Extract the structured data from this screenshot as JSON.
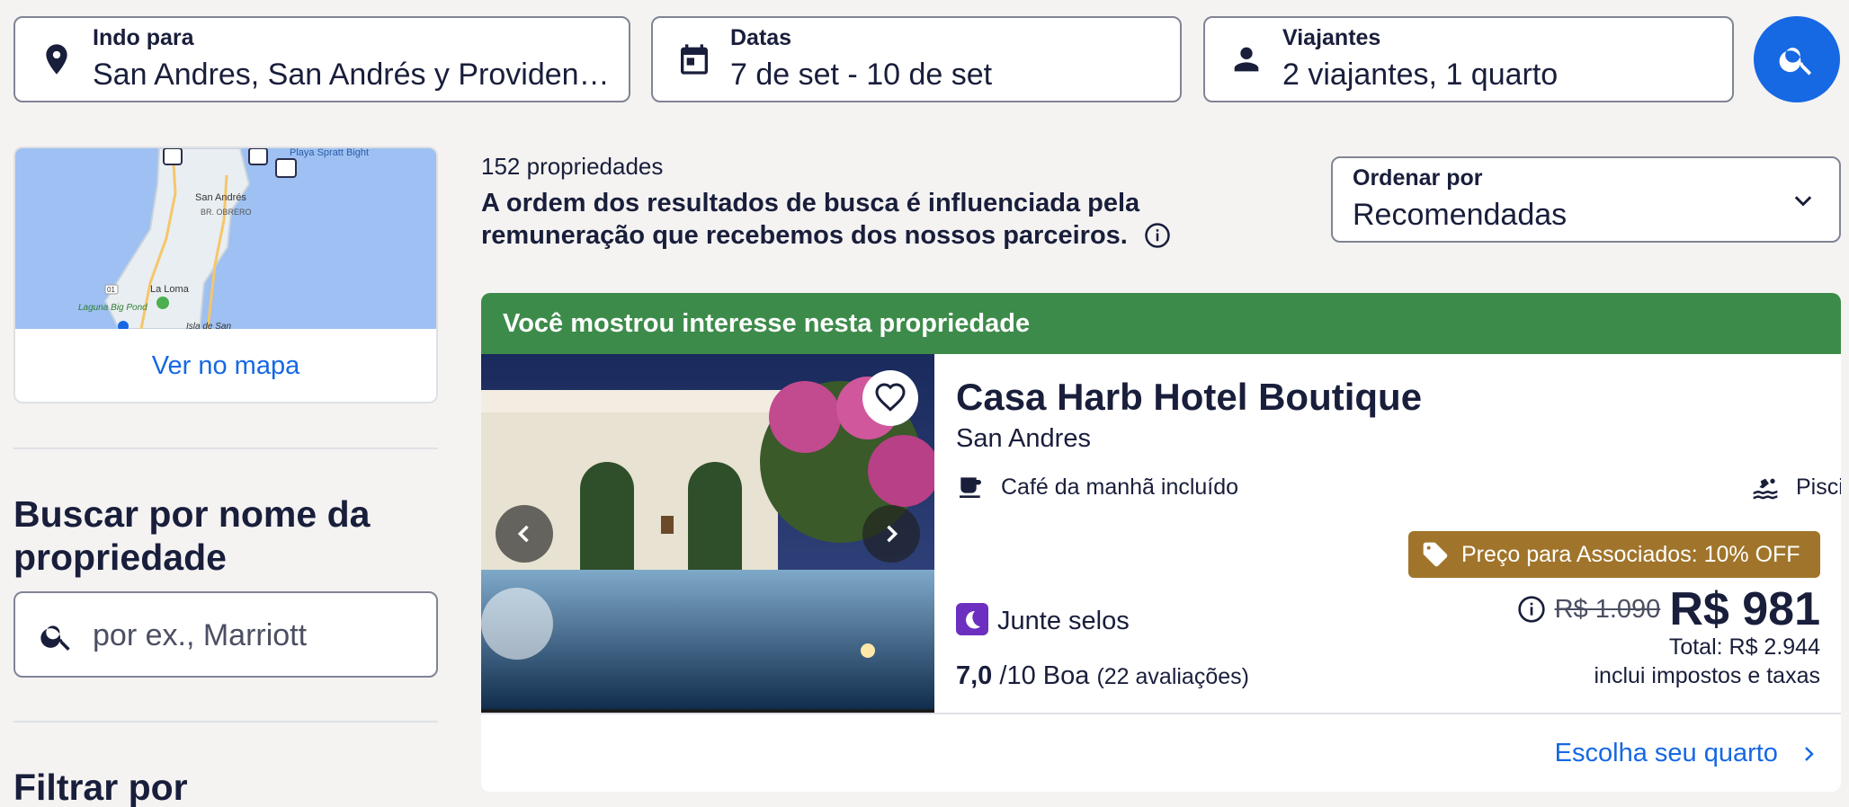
{
  "search_bar": {
    "destination": {
      "label": "Indo para",
      "value": "San Andres, San Andrés y Providencia, Colômbia",
      "icon": "location-pin-icon"
    },
    "dates": {
      "label": "Datas",
      "value": "7 de set - 10 de set",
      "icon": "calendar-icon"
    },
    "travelers": {
      "label": "Viajantes",
      "value": "2 viajantes, 1 quarto",
      "icon": "person-icon"
    },
    "search_button_icon": "search-icon"
  },
  "map": {
    "link_label": "Ver no mapa",
    "places": [
      "Playa Spratt Bight",
      "San Andrés",
      "BR. OBRERO",
      "La Loma",
      "Laguna Big Pond",
      "Isla de San"
    ],
    "route_labels": [
      "01"
    ]
  },
  "sidebar": {
    "name_search_heading": "Buscar por nome da propriedade",
    "name_search_placeholder": "por ex., Marriott",
    "filter_heading": "Filtrar por"
  },
  "results": {
    "count": "152 propriedades",
    "disclaimer": "A ordem dos resultados de busca é influenciada pela remuneração que recebemos dos nossos parceiros."
  },
  "sort": {
    "label": "Ordenar por",
    "value": "Recomendadas"
  },
  "card": {
    "banner": "Você mostrou interesse nesta propriedade",
    "name": "Casa Harb Hotel Boutique",
    "location": "San Andres",
    "amenities": [
      {
        "label": "Café da manhã incluído",
        "icon": "coffee-cup-icon"
      },
      {
        "label": "Piscina",
        "icon": "pool-icon"
      }
    ],
    "member_badge": "Preço para Associados: 10% OFF",
    "stamps": "Junte selos",
    "rating_score": "7,0",
    "rating_scale": "/10 Boa",
    "rating_count": "(22 avaliações)",
    "old_price": "R$ 1.090",
    "price": "R$ 981",
    "total": "Total: R$ 2.944",
    "taxes_note": "inclui impostos e taxas",
    "choose_room": "Escolha seu quarto"
  },
  "colors": {
    "accent": "#1668e3",
    "banner_green": "#3d8b4a",
    "member_gold": "#a0752b",
    "stamps_purple": "#6d2fbf"
  }
}
